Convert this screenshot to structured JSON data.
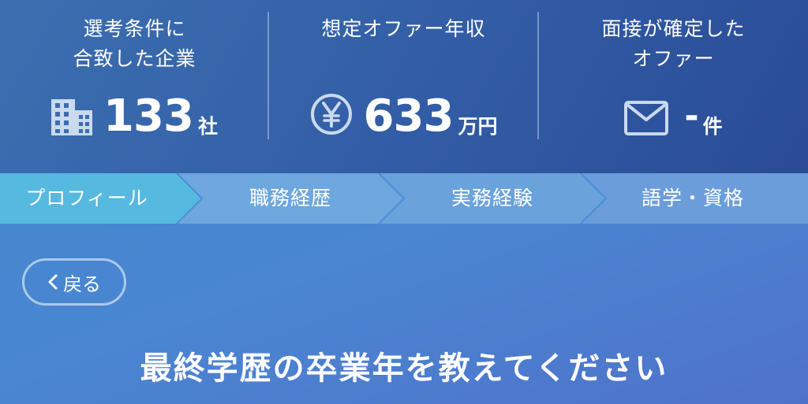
{
  "stats": [
    {
      "label_line1": "選考条件に",
      "label_line2": "合致した企業",
      "icon": "building-icon",
      "value": "133",
      "unit": "社"
    },
    {
      "label_line1": "想定オファー年収",
      "label_line2": "",
      "icon": "yen-icon",
      "value": "633",
      "unit": "万円"
    },
    {
      "label_line1": "面接が確定した",
      "label_line2": "オファー",
      "icon": "mail-icon",
      "value": "-",
      "unit": "件"
    }
  ],
  "progress": {
    "steps": [
      {
        "label": "プロフィール",
        "active": true
      },
      {
        "label": "職務経歴",
        "active": false
      },
      {
        "label": "実務経験",
        "active": false
      },
      {
        "label": "語学・資格",
        "active": false
      }
    ]
  },
  "back_button": {
    "label": "戻る"
  },
  "question": {
    "title": "最終学歴の卒業年を教えてください"
  },
  "colors": {
    "active_step": "#56b9e0",
    "inactive_step": "#6ea7de",
    "header_bg": "#335ea7"
  }
}
